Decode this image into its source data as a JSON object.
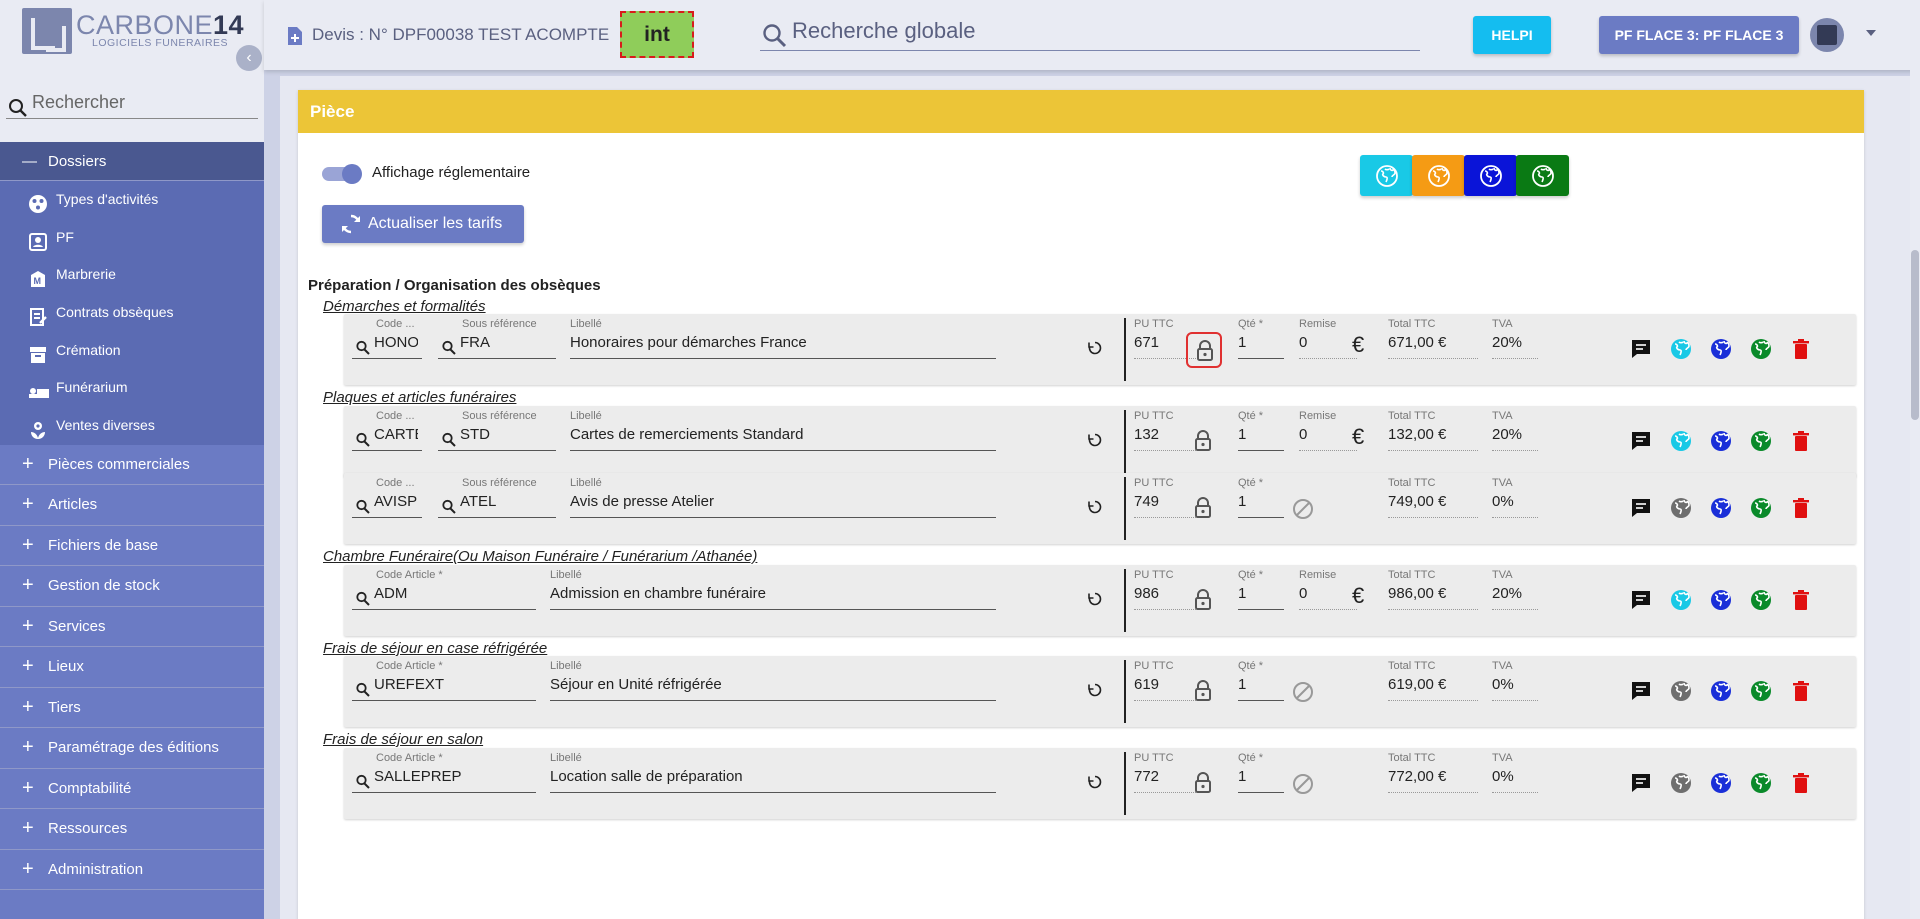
{
  "brand": {
    "name_light": "CARBONE",
    "name_bold": "14",
    "subtitle": "LOGICIELS FUNERAIRES"
  },
  "sidebar": {
    "search_placeholder": "Rechercher",
    "open_section": "Dossiers",
    "sub_items": [
      {
        "label": "Types d'activités",
        "icon": "activities-icon"
      },
      {
        "label": "PF",
        "icon": "contact-card-icon"
      },
      {
        "label": "Marbrerie",
        "icon": "marble-icon"
      },
      {
        "label": "Contrats obsèques",
        "icon": "contract-icon"
      },
      {
        "label": "Crémation",
        "icon": "urn-icon"
      },
      {
        "label": "Funérarium",
        "icon": "bed-icon"
      },
      {
        "label": "Ventes diverses",
        "icon": "flower-icon"
      }
    ],
    "items": [
      {
        "label": "Pièces commerciales"
      },
      {
        "label": "Articles"
      },
      {
        "label": "Fichiers de base"
      },
      {
        "label": "Gestion de stock"
      },
      {
        "label": "Services"
      },
      {
        "label": "Lieux"
      },
      {
        "label": "Tiers"
      },
      {
        "label": "Paramétrage des éditions"
      },
      {
        "label": "Comptabilité"
      },
      {
        "label": "Ressources"
      },
      {
        "label": "Administration"
      }
    ]
  },
  "topbar": {
    "doc_title": "Devis : N° DPF00038 TEST ACOMPTE",
    "tag": "int",
    "search_placeholder": "Recherche globale",
    "help_label": "HELPI",
    "pf_label": "PF FLACE 3: PF FLACE 3"
  },
  "piece": {
    "header": "Pièce",
    "toggle_label": "Affichage réglementaire",
    "refresh_label": "Actualiser les tarifs",
    "globe_colors": [
      "#19c9e6",
      "#f59b14",
      "#0a14d8",
      "#0a7a14"
    ],
    "section_title": "Préparation / Organisation des obsèques",
    "labels": {
      "code_short": "Code ...",
      "sous_ref": "Sous référence",
      "code_article": "Code Article *",
      "libelle": "Libellé",
      "pu": "PU TTC",
      "qte": "Qté *",
      "remise": "Remise",
      "total": "Total TTC",
      "tva": "TVA"
    },
    "groups": [
      {
        "title": "Démarches et formalités",
        "rows": [
          {
            "code": "HONO",
            "sous_ref": "FRA",
            "libelle": "Honoraires pour démarches France",
            "pu": "671",
            "qte": "1",
            "remise": "0",
            "total": "671,00 €",
            "tva": "20%",
            "highlight_lock": true,
            "status_color": "#19c9e6"
          }
        ]
      },
      {
        "title": "Plaques et articles funéraires",
        "rows": [
          {
            "code": "CARTE",
            "sous_ref": "STD",
            "libelle": "Cartes de remerciements Standard",
            "pu": "132",
            "qte": "1",
            "remise": "0",
            "total": "132,00 €",
            "tva": "20%",
            "status_color": "#19c9e6"
          },
          {
            "code": "AVISP",
            "sous_ref": "ATEL",
            "libelle": "Avis de presse Atelier",
            "pu": "749",
            "qte": "1",
            "total": "749,00 €",
            "tva": "0%",
            "status_color": "#6e6e6e"
          }
        ]
      },
      {
        "title": "Chambre Funéraire(Ou Maison Funéraire / Funérarium /Athanée)",
        "rows": [
          {
            "code": "ADM",
            "libelle": "Admission en chambre funéraire",
            "pu": "986",
            "qte": "1",
            "remise": "0",
            "total": "986,00 €",
            "tva": "20%",
            "status_color": "#19c9e6"
          }
        ]
      },
      {
        "title": "Frais de séjour en case réfrigérée",
        "rows": [
          {
            "code": "UREFEXT",
            "libelle": "Séjour en Unité réfrigérée",
            "pu": "619",
            "qte": "1",
            "total": "619,00 €",
            "tva": "0%",
            "status_color": "#6e6e6e"
          }
        ]
      },
      {
        "title": "Frais de séjour en salon",
        "rows": [
          {
            "code": "SALLEPREP",
            "libelle": "Location salle de préparation",
            "pu": "772",
            "qte": "1",
            "total": "772,00 €",
            "tva": "0%",
            "status_color": "#6e6e6e"
          }
        ]
      }
    ],
    "action_colors": {
      "comment": "#111111",
      "blue": "#1a2fd8",
      "green": "#0a8a2a",
      "delete": "#e01010"
    }
  }
}
